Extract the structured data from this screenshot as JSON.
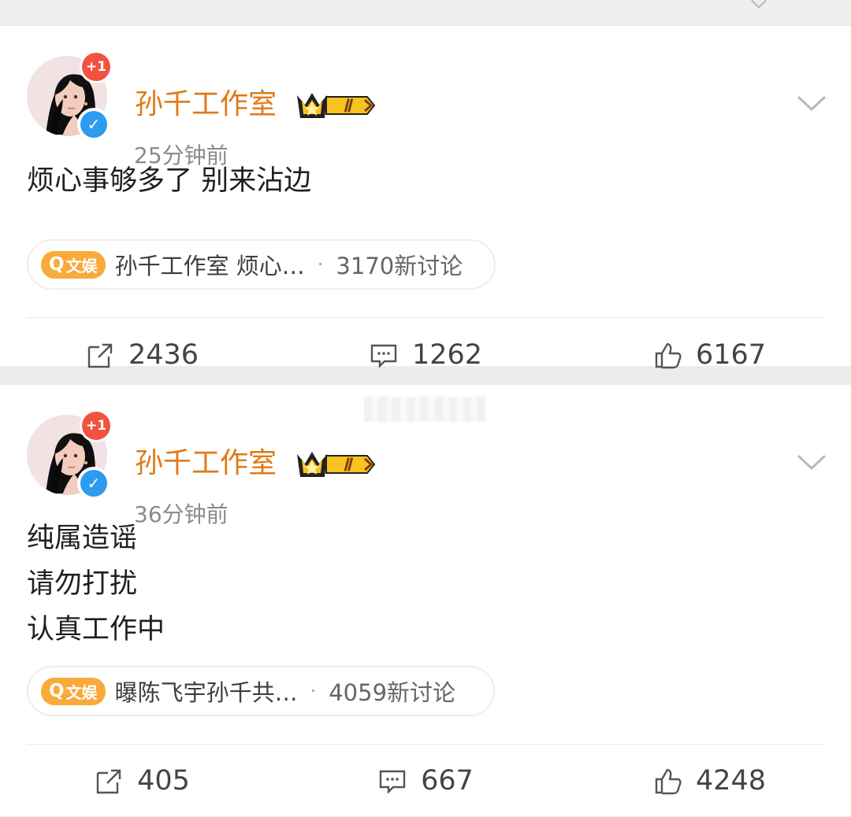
{
  "posts": [
    {
      "badge": "+1",
      "username": "孙千工作室",
      "rank": "Ⅱ",
      "time": "25分钟前",
      "content_lines": [
        "烦心事够多了 别来沾边"
      ],
      "topic": {
        "tag": "文娱",
        "title": "孙千工作室 烦心…",
        "separator": "·",
        "count": "3170新讨论"
      },
      "actions": {
        "repost": "2436",
        "comment": "1262",
        "like": "6167"
      }
    },
    {
      "badge": "+1",
      "username": "孙千工作室",
      "rank": "Ⅱ",
      "time": "36分钟前",
      "content_lines": [
        "纯属造谣",
        "请勿打扰",
        "认真工作中"
      ],
      "topic": {
        "tag": "文娱",
        "title": "曝陈飞宇孙千共…",
        "separator": "·",
        "count": "4059新讨论"
      },
      "actions": {
        "repost": "405",
        "comment": "667",
        "like": "4248"
      }
    }
  ],
  "colors": {
    "username": "#e07a18",
    "verified": "#2d9bf0",
    "badge": "#f15340",
    "topic_tag": "#f8aa3a"
  },
  "icons": [
    "repost-icon",
    "comment-icon",
    "like-icon",
    "verified-icon",
    "crown-icon",
    "chevron-down-icon"
  ]
}
